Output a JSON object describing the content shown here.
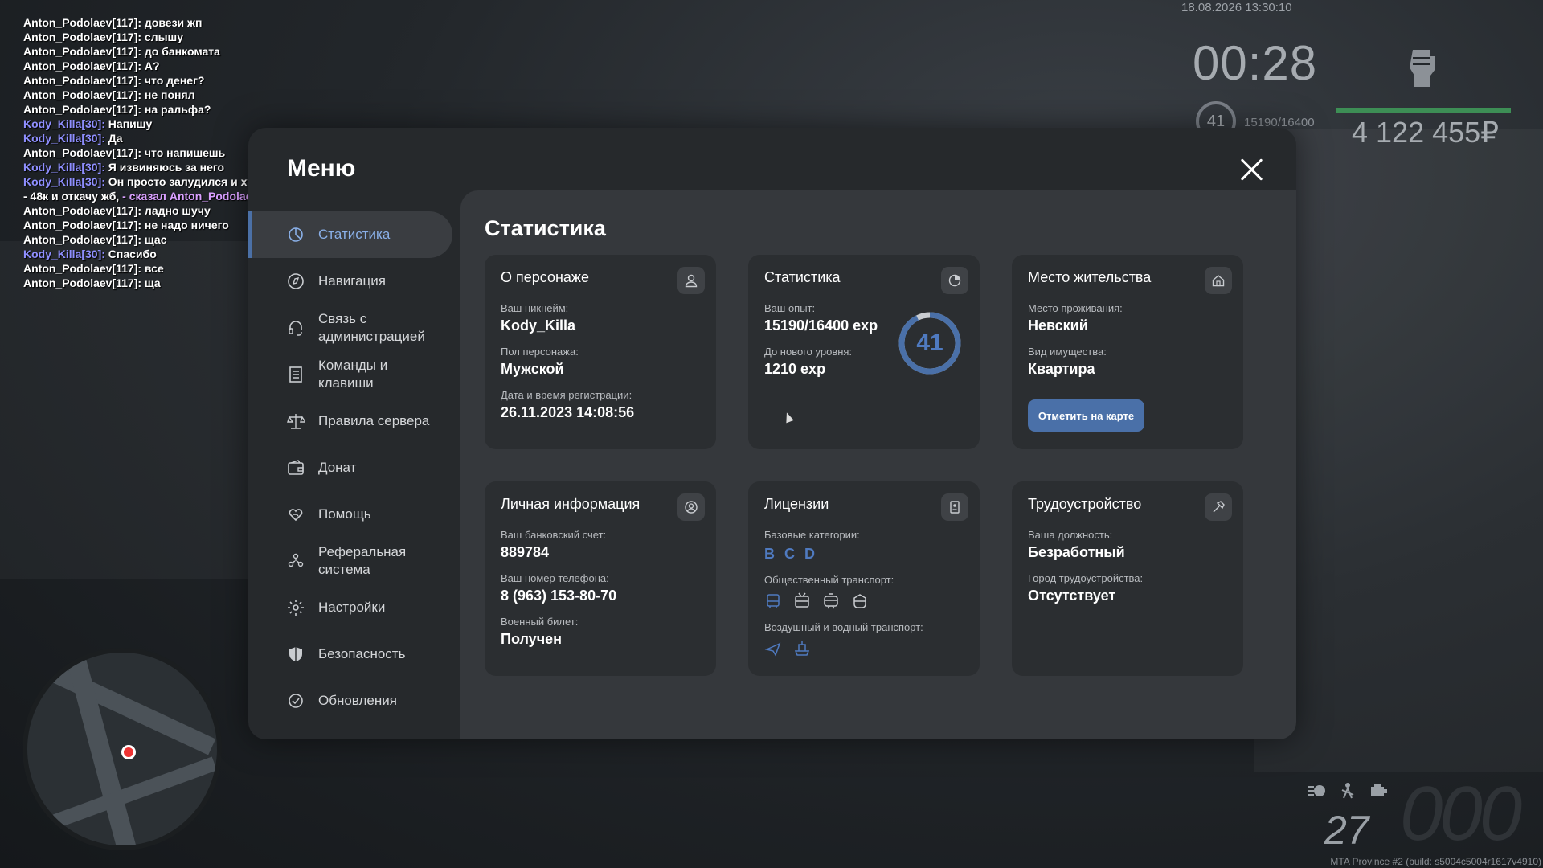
{
  "chat": [
    {
      "nick": "Anton_Podolaev[117]:",
      "text": " довези жп",
      "blue": false
    },
    {
      "nick": "Anton_Podolaev[117]:",
      "text": " слышу",
      "blue": false
    },
    {
      "nick": "Anton_Podolaev[117]:",
      "text": " до банкомата",
      "blue": false
    },
    {
      "nick": "Anton_Podolaev[117]:",
      "text": " А?",
      "blue": false
    },
    {
      "nick": "Anton_Podolaev[117]:",
      "text": " что денег?",
      "blue": false
    },
    {
      "nick": "Anton_Podolaev[117]:",
      "text": " не понял",
      "blue": false
    },
    {
      "nick": "Anton_Podolaev[117]:",
      "text": " на ральфа?",
      "blue": false
    },
    {
      "nick": "Kody_Killa[30]:",
      "text": " Напишу",
      "blue": true
    },
    {
      "nick": "Kody_Killa[30]:",
      "text": " Да",
      "blue": true
    },
    {
      "nick": "Anton_Podolaev[117]:",
      "text": " что напишешь",
      "blue": false
    },
    {
      "nick": "Kody_Killa[30]:",
      "text": " Я извиняюсь за него",
      "blue": true
    },
    {
      "nick": "Kody_Killa[30]:",
      "text": " Он просто залудился и хуйнес страдает",
      "blue": true
    },
    {
      "nick": "- 48к и откачу жб,",
      "text": " - сказал Anton_Podolaev, улыбнувшись.",
      "blue": false,
      "rp": true
    },
    {
      "nick": "Anton_Podolaev[117]:",
      "text": " ладно шучу",
      "blue": false
    },
    {
      "nick": "Anton_Podolaev[117]:",
      "text": " не надо ничего",
      "blue": false
    },
    {
      "nick": "Anton_Podolaev[117]:",
      "text": " щас",
      "blue": false
    },
    {
      "nick": "Kody_Killa[30]:",
      "text": " Спасибо",
      "blue": true
    },
    {
      "nick": "Anton_Podolaev[117]:",
      "text": " все",
      "blue": false
    },
    {
      "nick": "Anton_Podolaev[117]:",
      "text": " ща",
      "blue": false
    }
  ],
  "hud": {
    "datetime": "18.08.2026 13:30:10",
    "time": "00:28",
    "level": "41",
    "exp": "15190/16400",
    "money": "4 122 455₽",
    "speed": "27",
    "speed_digits": "000",
    "build": "MTA Province #2 (build: s5004c5004r1617v4910)"
  },
  "menu": {
    "title": "Меню",
    "close": "×",
    "nav": [
      {
        "name": "statistics",
        "label": "Статистика",
        "icon": "pie-chart-icon",
        "active": true
      },
      {
        "name": "navigation",
        "label": "Навигация",
        "icon": "compass-icon",
        "active": false
      },
      {
        "name": "admin-contact",
        "label": "Связь с администрацией",
        "icon": "headset-icon",
        "active": false
      },
      {
        "name": "commands",
        "label": "Команды и клавиши",
        "icon": "document-list-icon",
        "active": false
      },
      {
        "name": "rules",
        "label": "Правила сервера",
        "icon": "scales-icon",
        "active": false
      },
      {
        "name": "donate",
        "label": "Донат",
        "icon": "wallet-icon",
        "active": false
      },
      {
        "name": "help",
        "label": "Помощь",
        "icon": "heart-hand-icon",
        "active": false
      },
      {
        "name": "referral",
        "label": "Реферальная система",
        "icon": "people-icon",
        "active": false
      },
      {
        "name": "settings",
        "label": "Настройки",
        "icon": "gear-icon",
        "active": false
      },
      {
        "name": "security",
        "label": "Безопасность",
        "icon": "shield-icon",
        "active": false
      },
      {
        "name": "updates",
        "label": "Обновления",
        "icon": "check-circle-icon",
        "active": false
      }
    ]
  },
  "content": {
    "title": "Статистика",
    "character": {
      "title": "О персонаже",
      "icon": "user-icon",
      "nick_label": "Ваш никнейм:",
      "nick": "Kody_Killa",
      "gender_label": "Пол персонажа:",
      "gender": "Мужской",
      "reg_label": "Дата и время регистрации:",
      "reg": "26.11.2023 14:08:56"
    },
    "stats": {
      "title": "Статистика",
      "icon": "clock-pie-icon",
      "exp_label": "Ваш опыт:",
      "exp": "15190/16400 exp",
      "next_label": "До нового уровня:",
      "next": "1210 exp",
      "level": "41",
      "progress": 0.926
    },
    "residence": {
      "title": "Место жительства",
      "icon": "house-icon",
      "place_label": "Место проживания:",
      "place": "Невский",
      "type_label": "Вид имущества:",
      "type": "Квартира",
      "button": "Отметить на карте"
    },
    "personal": {
      "title": "Личная информация",
      "icon": "user-circle-icon",
      "bank_label": "Ваш банковский счет:",
      "bank": "889784",
      "phone_label": "Ваш номер телефона:",
      "phone": "8 (963) 153-80-70",
      "military_label": "Военный билет:",
      "military": "Получен"
    },
    "licenses": {
      "title": "Лицензии",
      "icon": "id-card-icon",
      "base_label": "Базовые категории:",
      "base": [
        "B",
        "C",
        "D"
      ],
      "public_label": "Общественный транспорт:",
      "public_icons": [
        "bus-icon",
        "trolleybus-icon",
        "tram-icon",
        "metro-icon"
      ],
      "air_label": "Воздушный и водный транспорт:",
      "air_icons": [
        "plane-icon",
        "boat-icon"
      ]
    },
    "job": {
      "title": "Трудоустройство",
      "icon": "hammer-icon",
      "position_label": "Ваша должность:",
      "position": "Безработный",
      "city_label": "Город трудоустройства:",
      "city": "Отсутствует"
    }
  },
  "colors": {
    "accent": "#4a70a8",
    "panel": "#26292c",
    "content": "#35383c",
    "card": "#2b2e31"
  }
}
